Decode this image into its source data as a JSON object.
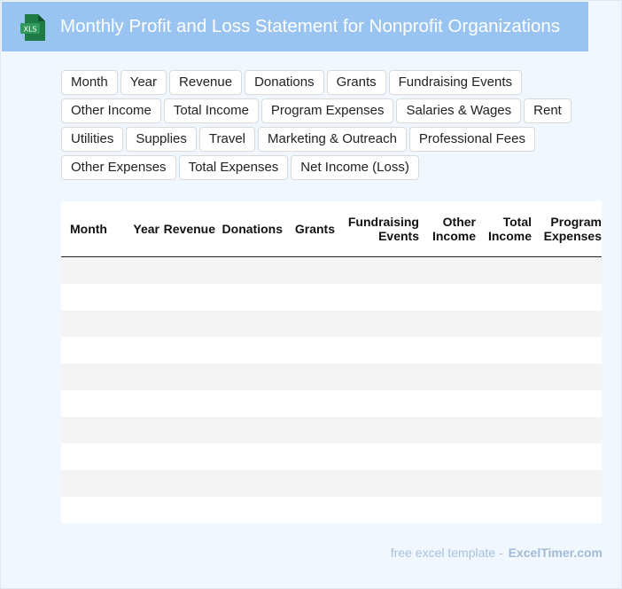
{
  "header": {
    "title": "Monthly Profit and Loss Statement for Nonprofit Organizations",
    "icon": "xls-file-icon",
    "icon_label": "XLS",
    "colors": {
      "banner": "#99c3f0",
      "icon_green": "#1f7a45"
    }
  },
  "chips": [
    "Month",
    "Year",
    "Revenue",
    "Donations",
    "Grants",
    "Fundraising Events",
    "Other Income",
    "Total Income",
    "Program Expenses",
    "Salaries & Wages",
    "Rent",
    "Utilities",
    "Supplies",
    "Travel",
    "Marketing & Outreach",
    "Professional Fees",
    "Other Expenses",
    "Total Expenses",
    "Net Income (Loss)"
  ],
  "table": {
    "columns": [
      [
        "Month"
      ],
      [
        "Year"
      ],
      [
        "Revenue"
      ],
      [
        "Donations"
      ],
      [
        "Grants"
      ],
      [
        "Fundraising",
        "Events"
      ],
      [
        "Other",
        "Income"
      ],
      [
        "Total",
        "Income"
      ],
      [
        "Program",
        "Expenses"
      ]
    ],
    "row_count": 10
  },
  "footer": {
    "text": "free excel template -",
    "brand": "ExcelTimer.com"
  }
}
